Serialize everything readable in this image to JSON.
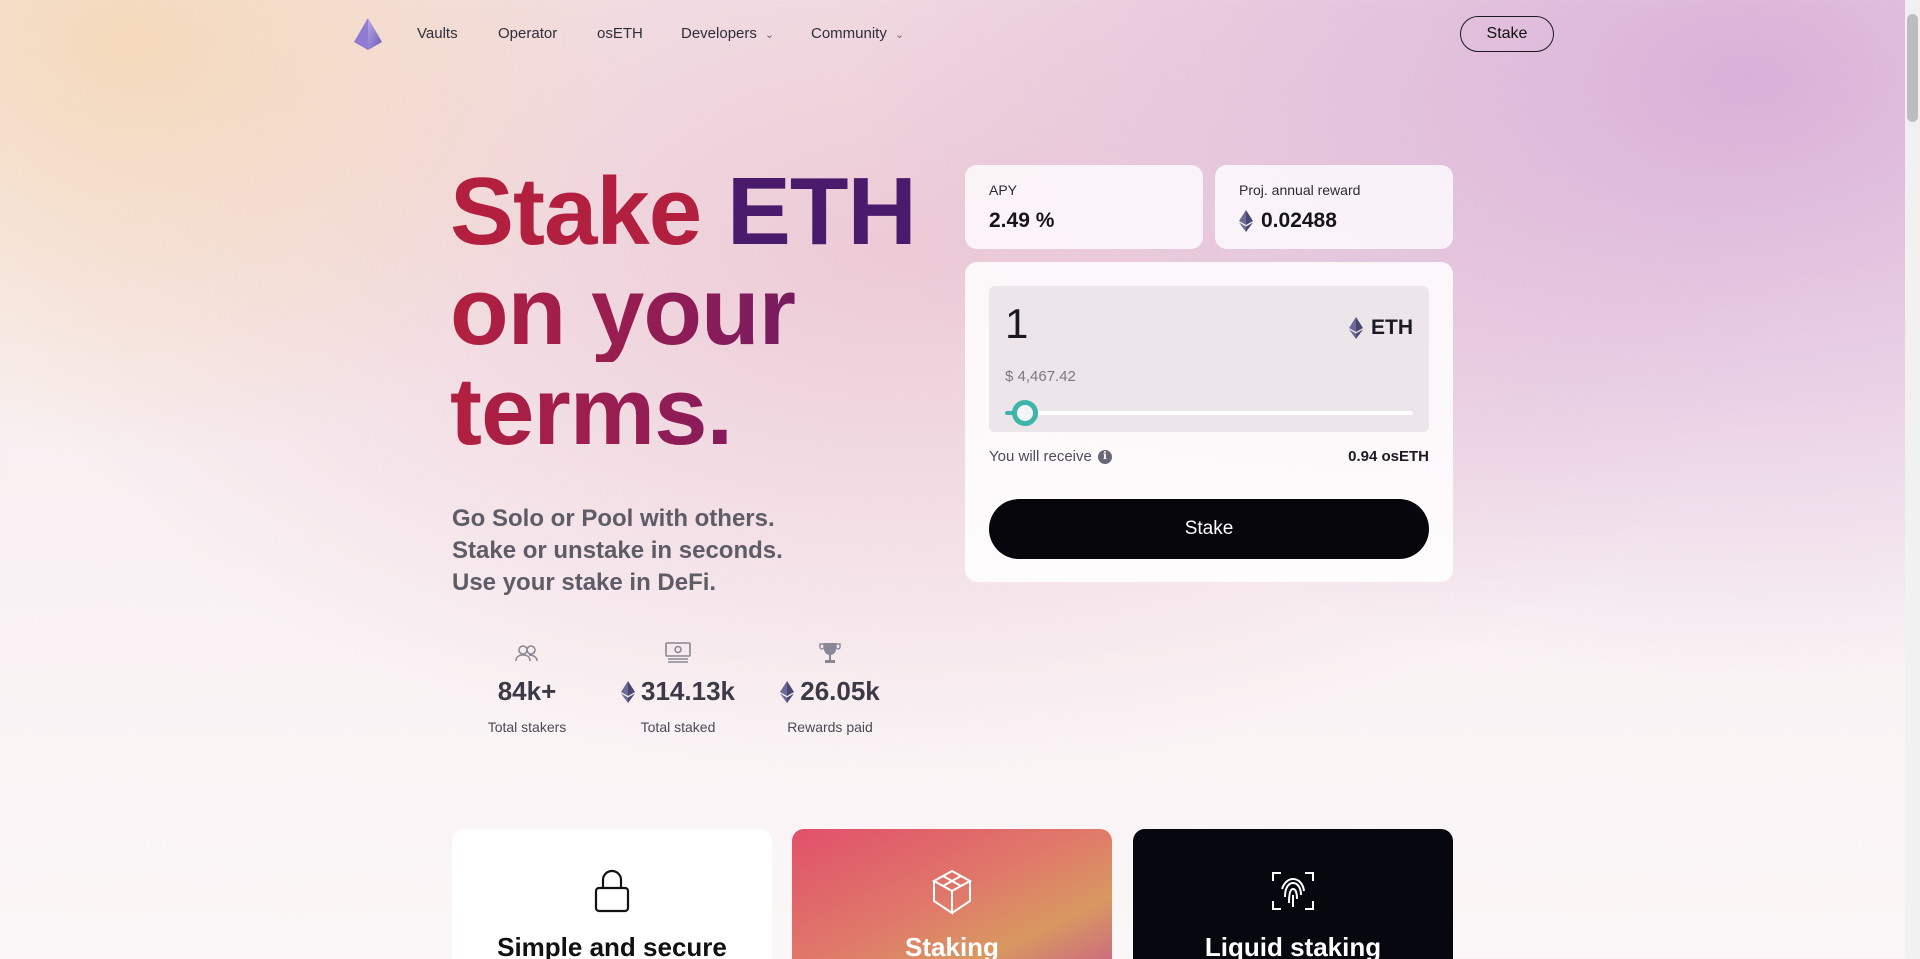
{
  "nav": {
    "links": [
      "Vaults",
      "Operator",
      "osETH"
    ],
    "dropdowns": [
      "Developers",
      "Community"
    ],
    "stake_button": "Stake"
  },
  "hero": {
    "title_line1_a": "Stake",
    "title_line1_b": "ETH",
    "title_line2": "on your",
    "title_line3": "terms.",
    "subtitle": [
      "Go Solo or Pool with others.",
      "Stake or unstake in seconds.",
      "Use your stake in DeFi."
    ]
  },
  "stats": [
    {
      "icon": "users-icon",
      "value": "84k+",
      "label": "Total stakers"
    },
    {
      "icon": "money-icon",
      "value": "314.13k",
      "label": "Total staked",
      "eth": true
    },
    {
      "icon": "trophy-icon",
      "value": "26.05k",
      "label": "Rewards paid",
      "eth": true
    }
  ],
  "apy": {
    "label": "APY",
    "value": "2.49 %"
  },
  "reward": {
    "label": "Proj. annual reward",
    "value": "0.02488"
  },
  "stake_form": {
    "amount": "1",
    "token": "ETH",
    "usd": "$ 4,467.42",
    "slider_fraction": 0.05,
    "receive_label": "You will receive",
    "receive_value": "0.94 osETH",
    "button": "Stake"
  },
  "features": [
    {
      "icon": "lock-icon",
      "title": "Simple and secure"
    },
    {
      "icon": "cube-icon",
      "title": "Staking"
    },
    {
      "icon": "fingerprint-icon",
      "title": "Liquid staking"
    }
  ],
  "colors": {
    "accent_teal": "#3fb4a8",
    "title_red": "#b3203f",
    "title_purple": "#4a1a6c",
    "button_dark": "#06060c"
  }
}
